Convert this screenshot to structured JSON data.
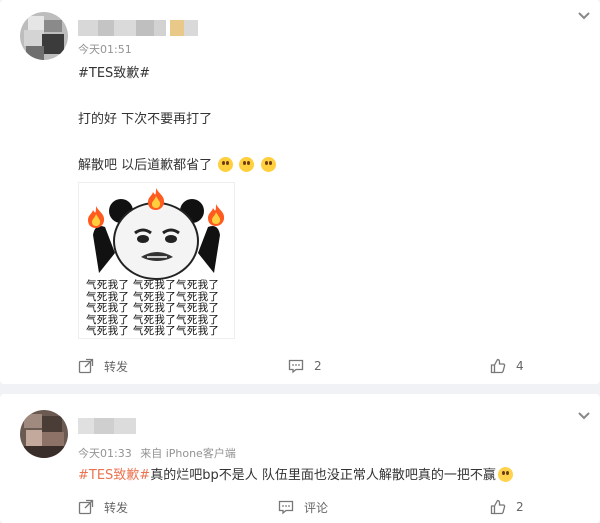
{
  "comments": [
    {
      "time": "今天01:51",
      "source": "",
      "hashtag": "#TES致歉#",
      "lines": [
        "打的好 下次不要再打了",
        "解散吧 以后道歉都省了"
      ],
      "emoji_count": 3,
      "meme": {
        "repeat_text": [
          "气死我了 气死我了气死我了",
          "气死我了 气死我了气死我了",
          "气死我了 气死我了气死我了",
          "气死我了 气死我了气死我了",
          "气死我了 气死我了气死我了"
        ]
      },
      "actions": {
        "repost_label": "转发",
        "comment_value": "2",
        "like_count": "4"
      }
    },
    {
      "time": "今天01:33",
      "source": "来自 iPhone客户端",
      "hashtag": "#TES致歉#",
      "text": "真的烂吧bp不是人 队伍里面也没正常人解散吧真的一把不赢",
      "actions": {
        "repost_label": "转发",
        "comment_label": "评论",
        "like_count": "2"
      }
    }
  ],
  "colors": {
    "accent": "#eb7350",
    "meta": "#939393",
    "page_bg": "#f1f2f5"
  },
  "icons": [
    "chevron-down-icon",
    "repost-icon",
    "comment-icon",
    "like-icon",
    "fire-icon"
  ]
}
